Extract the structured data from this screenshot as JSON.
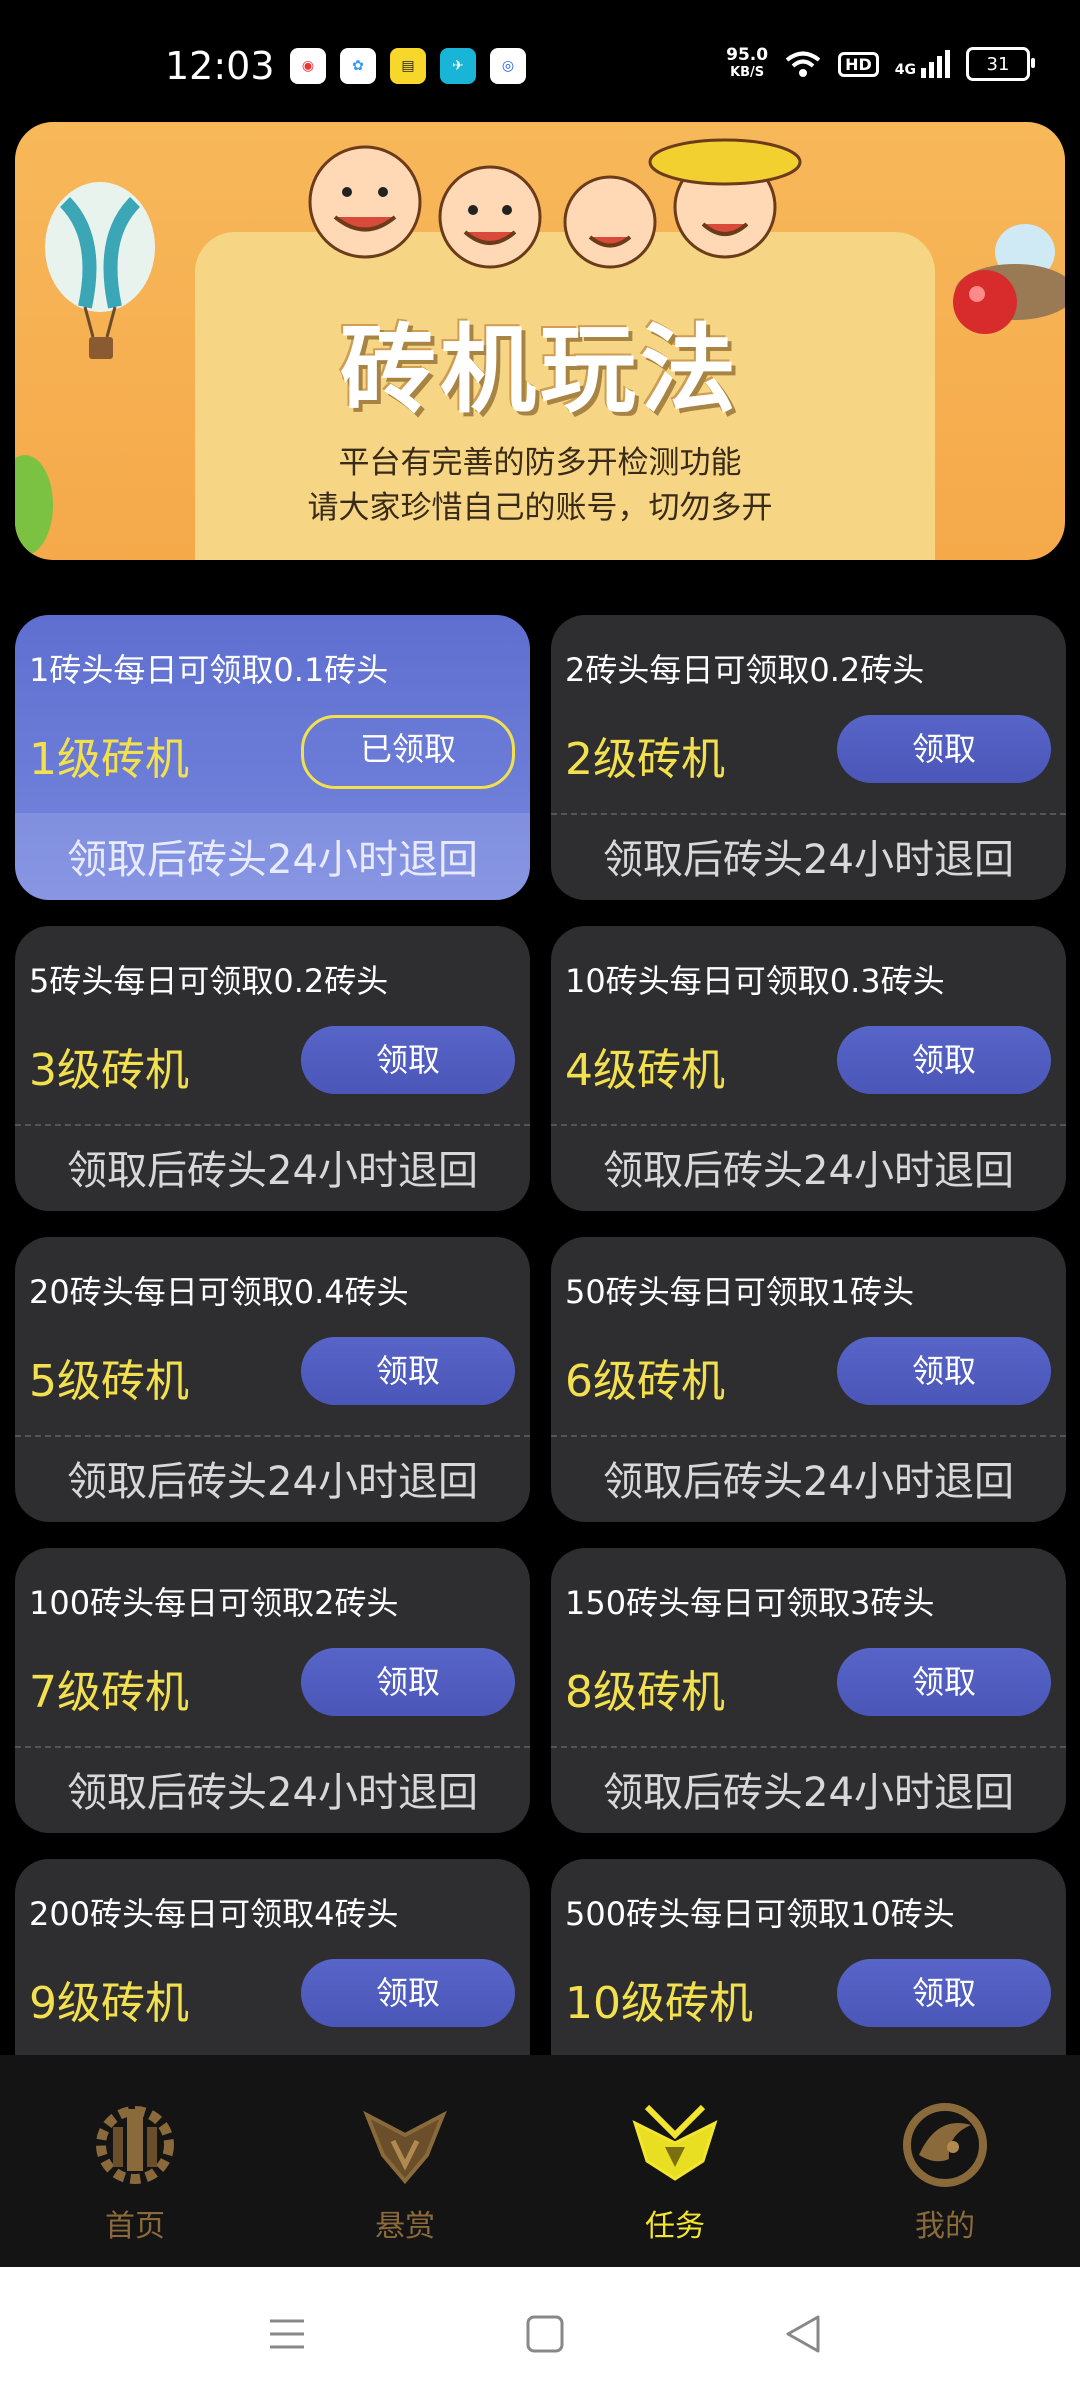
{
  "status_bar": {
    "time": "12:03",
    "net_speed_value": "95.0",
    "net_speed_unit": "KB/S",
    "hd_label": "HD",
    "network_type": "4G",
    "battery": "31",
    "apps": [
      "app-1",
      "app-2",
      "app-3",
      "app-4",
      "app-5"
    ]
  },
  "banner": {
    "title": "砖机玩法",
    "subtitle_line1": "平台有完善的防多开检测功能",
    "subtitle_line2": "请大家珍惜自己的账号，切勿多开"
  },
  "machines": [
    {
      "desc": "1砖头每日可领取0.1砖头",
      "level": "1级砖机",
      "button": "已领取",
      "footer": "领取后砖头24小时退回",
      "claimed": true
    },
    {
      "desc": "2砖头每日可领取0.2砖头",
      "level": "2级砖机",
      "button": "领取",
      "footer": "领取后砖头24小时退回",
      "claimed": false
    },
    {
      "desc": "5砖头每日可领取0.2砖头",
      "level": "3级砖机",
      "button": "领取",
      "footer": "领取后砖头24小时退回",
      "claimed": false
    },
    {
      "desc": "10砖头每日可领取0.3砖头",
      "level": "4级砖机",
      "button": "领取",
      "footer": "领取后砖头24小时退回",
      "claimed": false
    },
    {
      "desc": "20砖头每日可领取0.4砖头",
      "level": "5级砖机",
      "button": "领取",
      "footer": "领取后砖头24小时退回",
      "claimed": false
    },
    {
      "desc": "50砖头每日可领取1砖头",
      "level": "6级砖机",
      "button": "领取",
      "footer": "领取后砖头24小时退回",
      "claimed": false
    },
    {
      "desc": "100砖头每日可领取2砖头",
      "level": "7级砖机",
      "button": "领取",
      "footer": "领取后砖头24小时退回",
      "claimed": false
    },
    {
      "desc": "150砖头每日可领取3砖头",
      "level": "8级砖机",
      "button": "领取",
      "footer": "领取后砖头24小时退回",
      "claimed": false
    },
    {
      "desc": "200砖头每日可领取4砖头",
      "level": "9级砖机",
      "button": "领取",
      "footer": "",
      "claimed": false
    },
    {
      "desc": "500砖头每日可领取10砖头",
      "level": "10级砖机",
      "button": "领取",
      "footer": "",
      "claimed": false
    }
  ],
  "bottom_nav": {
    "items": [
      {
        "label": "首页",
        "icon": "home-emblem-icon",
        "active": false
      },
      {
        "label": "悬赏",
        "icon": "bounty-emblem-icon",
        "active": false
      },
      {
        "label": "任务",
        "icon": "task-emblem-icon",
        "active": true
      },
      {
        "label": "我的",
        "icon": "profile-emblem-icon",
        "active": false
      }
    ]
  },
  "colors": {
    "level_text": "#f3e04e",
    "button_bg": "#5865c8",
    "card_bg": "#2e2e30",
    "active_nav": "#f4e62e",
    "inactive_nav": "#8a6a3a"
  }
}
